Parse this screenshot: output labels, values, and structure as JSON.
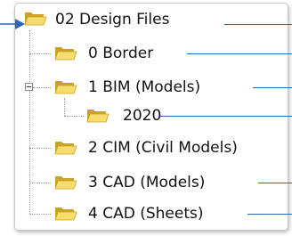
{
  "tree": {
    "items": [
      {
        "label": "02 Design Files",
        "level": 0,
        "icon": "folder-open-icon"
      },
      {
        "label": "0 Border",
        "level": 1,
        "icon": "folder-open-icon"
      },
      {
        "label": "1 BIM (Models)",
        "level": 1,
        "icon": "folder-open-icon",
        "expanded": true
      },
      {
        "label": "2020",
        "level": 2,
        "icon": "folder-open-icon"
      },
      {
        "label": "2 CIM (Civil Models)",
        "level": 1,
        "icon": "folder-open-icon"
      },
      {
        "label": "3 CAD (Models)",
        "level": 1,
        "icon": "folder-open-icon"
      },
      {
        "label": "4 CAD (Sheets)",
        "level": 1,
        "icon": "folder-open-icon"
      }
    ]
  },
  "colors": {
    "folder_light": "#f7dc6f",
    "folder_dark": "#c9a227",
    "tree_line": "#9a9a9a",
    "callout_arrow": "#2f67b1"
  }
}
